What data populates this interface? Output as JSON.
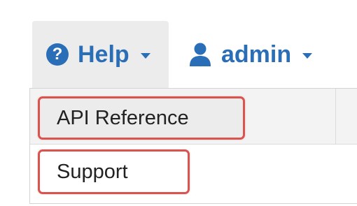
{
  "navbar": {
    "help": {
      "label": "Help",
      "icon": "question-circle-icon",
      "icon_glyph": "?"
    },
    "user": {
      "label": "admin",
      "icon": "user-icon"
    }
  },
  "dropdown": {
    "items": [
      {
        "label": "API Reference",
        "highlighted": true
      },
      {
        "label": "Support",
        "highlighted": true
      }
    ]
  },
  "colors": {
    "link": "#2a6eb8",
    "highlight_border": "#d9534f",
    "active_bg": "#ececec"
  }
}
